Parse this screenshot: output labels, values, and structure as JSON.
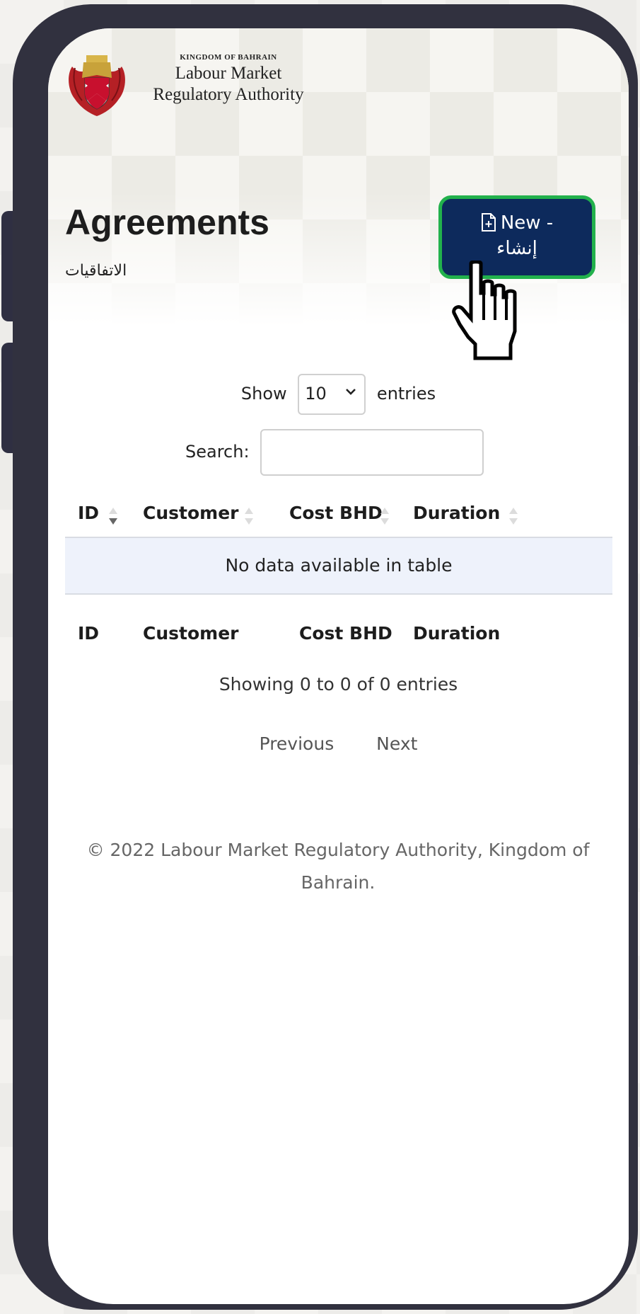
{
  "brand": {
    "kingdom": "KINGDOM OF BAHRAIN",
    "line1": "Labour Market",
    "line2": "Regulatory Authority"
  },
  "page": {
    "title": "Agreements",
    "subtitle": "الاتفاقيات"
  },
  "new_button": {
    "line1": "New -",
    "line2": "إنشاء",
    "border_color": "#22b14c",
    "background_color": "#0d2a5c"
  },
  "length_control": {
    "prefix": "Show",
    "selected": "10",
    "suffix": "entries"
  },
  "search": {
    "label": "Search:",
    "value": ""
  },
  "table": {
    "headers": [
      "ID",
      "Customer",
      "Cost BHD",
      "Duration"
    ],
    "empty_message": "No data available in table",
    "footers": [
      "ID",
      "Customer",
      "Cost BHD",
      "Duration"
    ]
  },
  "info": "Showing 0 to 0 of 0 entries",
  "pagination": {
    "previous": "Previous",
    "next": "Next"
  },
  "footer": {
    "line1": "© 2022 Labour Market Regulatory Authority, Kingdom of",
    "line2": "Bahrain."
  }
}
